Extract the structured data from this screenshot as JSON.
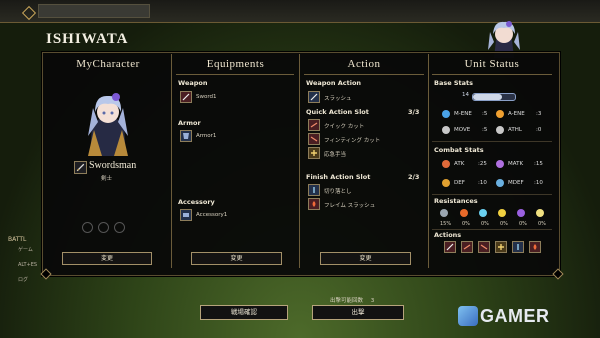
{
  "header": {
    "character_name": "ISHIWATA"
  },
  "columns": {
    "mycharacter": "MyCharacter",
    "equipments": "Equipments",
    "action": "Action",
    "unit_status": "Unit Status"
  },
  "character": {
    "class_name": "Swordsman",
    "class_sub": "剣士",
    "change_label": "変更"
  },
  "equipments": {
    "weapon_label": "Weapon",
    "weapon_item": "Sword1",
    "armor_label": "Armor",
    "armor_item": "Armor1",
    "accessory_label": "Accessory",
    "accessory_item": "Accessory1",
    "change_label": "変更"
  },
  "action": {
    "weapon_action_label": "Weapon Action",
    "weapon_action_item": "スラッシュ",
    "quick_slot_label": "Quick Action Slot",
    "quick_slot_count": "3/3",
    "quick_items": [
      "クイック カット",
      "フィンティング カット",
      "応急手当"
    ],
    "finish_slot_label": "Finish Action Slot",
    "finish_slot_count": "2/3",
    "finish_items": [
      "切り落とし",
      "フレイム スラッシュ"
    ],
    "change_label": "変更"
  },
  "unit_status": {
    "base_stats_label": "Base Stats",
    "level": "14",
    "base": [
      {
        "name": "M-ENE",
        "value": ":5",
        "color": "#4aa3e8"
      },
      {
        "name": "A-ENE",
        "value": ":3",
        "color": "#f0a030"
      },
      {
        "name": "MOVE",
        "value": ":5",
        "color": "#c8c8c8"
      },
      {
        "name": "ATHL",
        "value": ":0",
        "color": "#c8c8c8"
      }
    ],
    "combat_stats_label": "Combat Stats",
    "combat": [
      {
        "name": "ATK",
        "value": ":25",
        "color": "#e06a3a"
      },
      {
        "name": "MATK",
        "value": ":15",
        "color": "#b070e0"
      },
      {
        "name": "DEF",
        "value": ":10",
        "color": "#e0a030"
      },
      {
        "name": "MDEF",
        "value": ":10",
        "color": "#6ab0e0"
      }
    ],
    "resistances_label": "Resistances",
    "resist_values": [
      "15%",
      "0%",
      "0%",
      "0%",
      "0%",
      "0%"
    ],
    "resist_colors": [
      "#9aa6b0",
      "#e86a2a",
      "#6ad0f0",
      "#f0d040",
      "#9a60e0",
      "#f0e080"
    ],
    "actions_label": "Actions"
  },
  "side": {
    "battle_label": "BATTL",
    "line1": "ゲーム",
    "line2": "ALT+ES",
    "line3": "ログ"
  },
  "bottom": {
    "sortie_count_label": "出撃可能回数",
    "sortie_count": "3",
    "battlefield_btn": "戦場確認",
    "sortie_btn": "出撃"
  },
  "watermark": {
    "text": "GAMER"
  }
}
